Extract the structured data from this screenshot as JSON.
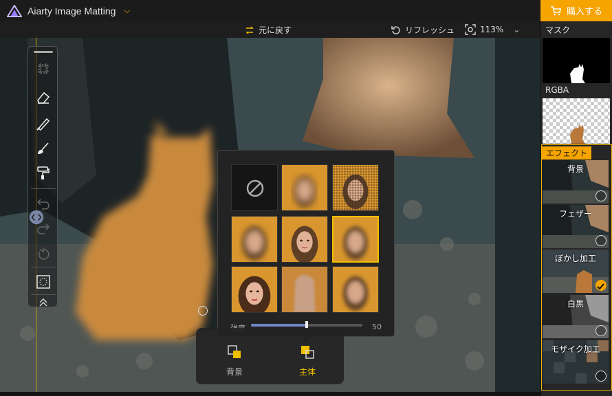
{
  "app": {
    "title": "Aiarty Image Matting",
    "buy_label": "購入する"
  },
  "toolbar": {
    "undo_label": "元に戻す",
    "refresh_label": "リフレッシュ",
    "zoom": "113%"
  },
  "right_panel": {
    "mask_label": "マスク",
    "rgba_label": "RGBA",
    "effects_tab": "エフェクト",
    "effects": [
      {
        "label": "背景",
        "selected": false
      },
      {
        "label": "フェザー",
        "selected": false
      },
      {
        "label": "ぼかし加工",
        "selected": true
      },
      {
        "label": "白黒",
        "selected": false
      },
      {
        "label": "モザイク加工",
        "selected": false
      }
    ]
  },
  "popup": {
    "strength_label": "強度",
    "strength_value": "50",
    "strength_fraction": 0.5,
    "selected_index": 5
  },
  "target": {
    "background_label": "背景",
    "subject_label": "主体",
    "active": "subject"
  },
  "colors": {
    "accent": "#f5a400",
    "highlight": "#f0c000"
  },
  "icons": [
    "crop-icon",
    "eraser-icon",
    "brush-icon",
    "broom-icon",
    "roller-icon",
    "undo-icon",
    "redo-icon",
    "reset-icon",
    "lasso-icon",
    "collapse-icon"
  ]
}
